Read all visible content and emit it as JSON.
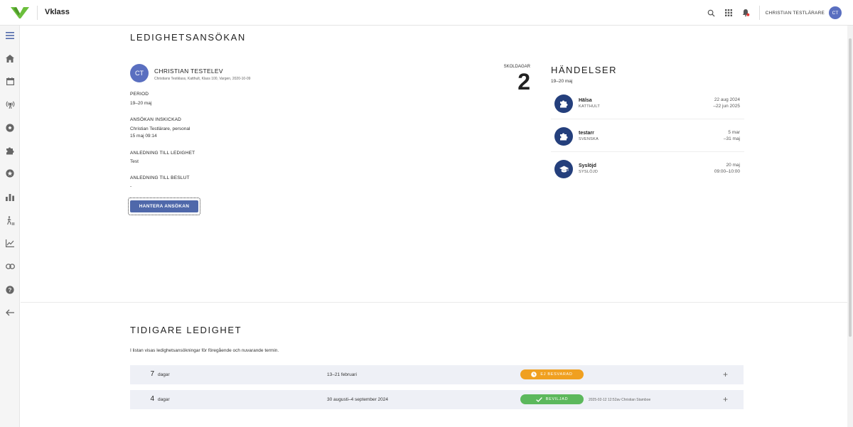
{
  "app": {
    "title": "Vklass"
  },
  "header": {
    "user_name": "CHRISTIAN TESTLÄRARE",
    "user_initials": "CT"
  },
  "sidebar": {
    "items": [
      {
        "icon": "menu-icon"
      },
      {
        "icon": "home-icon"
      },
      {
        "icon": "calendar-icon"
      },
      {
        "icon": "broadcast-icon"
      },
      {
        "icon": "football-icon"
      },
      {
        "icon": "puzzle-icon"
      },
      {
        "icon": "star-badge-icon"
      },
      {
        "icon": "bar-chart-icon"
      },
      {
        "icon": "walking-person-icon"
      },
      {
        "icon": "line-chart-icon"
      },
      {
        "icon": "link-icon"
      },
      {
        "icon": "help-icon"
      },
      {
        "icon": "arrow-back-icon"
      }
    ]
  },
  "page": {
    "title": "LEDIGHETSANSÖKAN"
  },
  "student": {
    "initials": "CT",
    "name": "CHRISTIAN TESTELEV",
    "subtitle": "Christians Testklass, Katthult, Klass 100, Vargen, 2020-10-09"
  },
  "fields": {
    "period_label": "PERIOD",
    "period_value": "19–20 maj",
    "submitted_label": "ANSÖKAN INSKICKAD",
    "submitted_by": "Christian Testlärare, personal",
    "submitted_at": "15 maj 09:14",
    "reason_label": "ANLEDNING TILL LEDIGHET",
    "reason_value": "Test",
    "decision_label": "ANLEDNING TILL BESLUT",
    "decision_value": "-"
  },
  "actions": {
    "handle_label": "HANTERA ANSÖKAN"
  },
  "school_days": {
    "label": "SKOLDAGAR",
    "value": "2"
  },
  "events": {
    "title": "HÄNDELSER",
    "subtitle": "19–20 maj",
    "items": [
      {
        "name": "Hälsa",
        "sub": "KATTHULT",
        "date1": "22 aug 2024",
        "date2": "–22 jun 2025",
        "icon": "puzzle-icon"
      },
      {
        "name": "testarr",
        "sub": "SVENSKA",
        "date1": "5 mar",
        "date2": "–31 maj",
        "icon": "puzzle-icon"
      },
      {
        "name": "Syslöjd",
        "sub": "SYSLÖJD",
        "date1": "20 maj",
        "date2": "09:00–10:00",
        "icon": "graduation-cap-icon"
      }
    ]
  },
  "previous": {
    "title": "TIDIGARE LEDIGHET",
    "description": "I listan visas ledighetsansökningar för föregående och nuvarande termin.",
    "rows": [
      {
        "days": "7",
        "unit": "dagar",
        "period": "13–21 februari",
        "status": "EJ BESVARAD",
        "status_color": "#f0a020",
        "status_icon": "clock-icon",
        "meta": ""
      },
      {
        "days": "4",
        "unit": "dagar",
        "period": "30 augusti–4 september 2024",
        "status": "BEVILJAD",
        "status_color": "#5cb85c",
        "status_icon": "check-icon",
        "meta": "2025-02-12 12:52av Christian Stamboe"
      }
    ]
  },
  "colors": {
    "brand_green": "#6bbf3c",
    "primary_button": "#4f68aa",
    "avatar": "#5a6fc0",
    "event_icon": "#243f7c",
    "row_bg": "#eef0f6"
  }
}
